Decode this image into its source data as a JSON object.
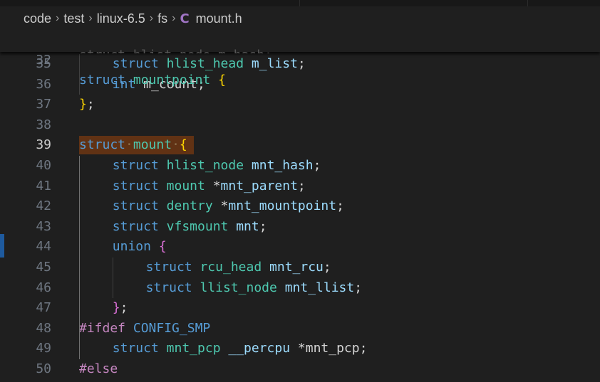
{
  "breadcrumb": {
    "items": [
      "code",
      "test",
      "linux-6.5",
      "fs"
    ],
    "file_icon": "C",
    "file_name": "mount.h"
  },
  "sticky": {
    "line_no": "32",
    "text": "struct mountpoint {"
  },
  "lines": [
    {
      "no": "35",
      "tokens": [
        [
          "kw",
          "struct"
        ],
        [
          "pu",
          " "
        ],
        [
          "ty",
          "hlist_head"
        ],
        [
          "pu",
          " "
        ],
        [
          "id",
          "m_list"
        ],
        [
          "pu",
          ";"
        ]
      ],
      "indent": 1
    },
    {
      "no": "36",
      "tokens": [
        [
          "kw",
          "int"
        ],
        [
          "pu",
          " m_count;"
        ]
      ],
      "indent": 1
    },
    {
      "no": "37",
      "tokens": [
        [
          "br",
          "}"
        ],
        [
          "pu",
          ";"
        ]
      ],
      "indent": 0
    },
    {
      "no": "38",
      "tokens": [],
      "indent": 0
    },
    {
      "no": "39",
      "tokens": [],
      "indent": 0
    },
    {
      "no": "40",
      "tokens": [
        [
          "kw",
          "struct"
        ],
        [
          "pu",
          " "
        ],
        [
          "ty",
          "hlist_node"
        ],
        [
          "pu",
          " "
        ],
        [
          "id",
          "mnt_hash"
        ],
        [
          "pu",
          ";"
        ]
      ],
      "indent": 1
    },
    {
      "no": "41",
      "tokens": [
        [
          "kw",
          "struct"
        ],
        [
          "pu",
          " "
        ],
        [
          "ty",
          "mount"
        ],
        [
          "pu",
          " *"
        ],
        [
          "id",
          "mnt_parent"
        ],
        [
          "pu",
          ";"
        ]
      ],
      "indent": 1
    },
    {
      "no": "42",
      "tokens": [
        [
          "kw",
          "struct"
        ],
        [
          "pu",
          " "
        ],
        [
          "ty",
          "dentry"
        ],
        [
          "pu",
          " *"
        ],
        [
          "id",
          "mnt_mountpoint"
        ],
        [
          "pu",
          ";"
        ]
      ],
      "indent": 1
    },
    {
      "no": "43",
      "tokens": [
        [
          "kw",
          "struct"
        ],
        [
          "pu",
          " "
        ],
        [
          "ty",
          "vfsmount"
        ],
        [
          "pu",
          " "
        ],
        [
          "id",
          "mnt"
        ],
        [
          "pu",
          ";"
        ]
      ],
      "indent": 1
    },
    {
      "no": "44",
      "tokens": [
        [
          "kw",
          "union"
        ],
        [
          "pu",
          " "
        ],
        [
          "br2",
          "{"
        ]
      ],
      "indent": 1
    },
    {
      "no": "45",
      "tokens": [
        [
          "kw",
          "struct"
        ],
        [
          "pu",
          " "
        ],
        [
          "ty",
          "rcu_head"
        ],
        [
          "pu",
          " "
        ],
        [
          "id",
          "mnt_rcu"
        ],
        [
          "pu",
          ";"
        ]
      ],
      "indent": 2
    },
    {
      "no": "46",
      "tokens": [
        [
          "kw",
          "struct"
        ],
        [
          "pu",
          " "
        ],
        [
          "ty",
          "llist_node"
        ],
        [
          "pu",
          " "
        ],
        [
          "id",
          "mnt_llist"
        ],
        [
          "pu",
          ";"
        ]
      ],
      "indent": 2
    },
    {
      "no": "47",
      "tokens": [
        [
          "br2",
          "}"
        ],
        [
          "pu",
          ";"
        ]
      ],
      "indent": 1
    },
    {
      "no": "48",
      "tokens": [
        [
          "pp",
          "#ifdef"
        ],
        [
          "pu",
          " "
        ],
        [
          "mac",
          "CONFIG_SMP"
        ]
      ],
      "indent": 0
    },
    {
      "no": "49",
      "tokens": [
        [
          "kw",
          "struct"
        ],
        [
          "pu",
          " "
        ],
        [
          "ty",
          "mnt_pcp"
        ],
        [
          "pu",
          " "
        ],
        [
          "id",
          "__percpu"
        ],
        [
          "pu",
          " *mnt_pcp;"
        ]
      ],
      "indent": 1
    },
    {
      "no": "50",
      "tokens": [
        [
          "pp",
          "#else"
        ]
      ],
      "indent": 0
    }
  ],
  "highlight_line": {
    "no": "39",
    "keyword": "struct",
    "name": "mount",
    "brace": "{"
  },
  "active_line": "39",
  "colors": {
    "background": "#1f1f1f",
    "keyword": "#569cd6",
    "type": "#4ec9b0",
    "identifier": "#9cdcfe",
    "bracket_gold": "#ffd700",
    "bracket_magenta": "#da70d6",
    "preprocessor": "#c586c0",
    "selection_highlight": "#613214"
  }
}
